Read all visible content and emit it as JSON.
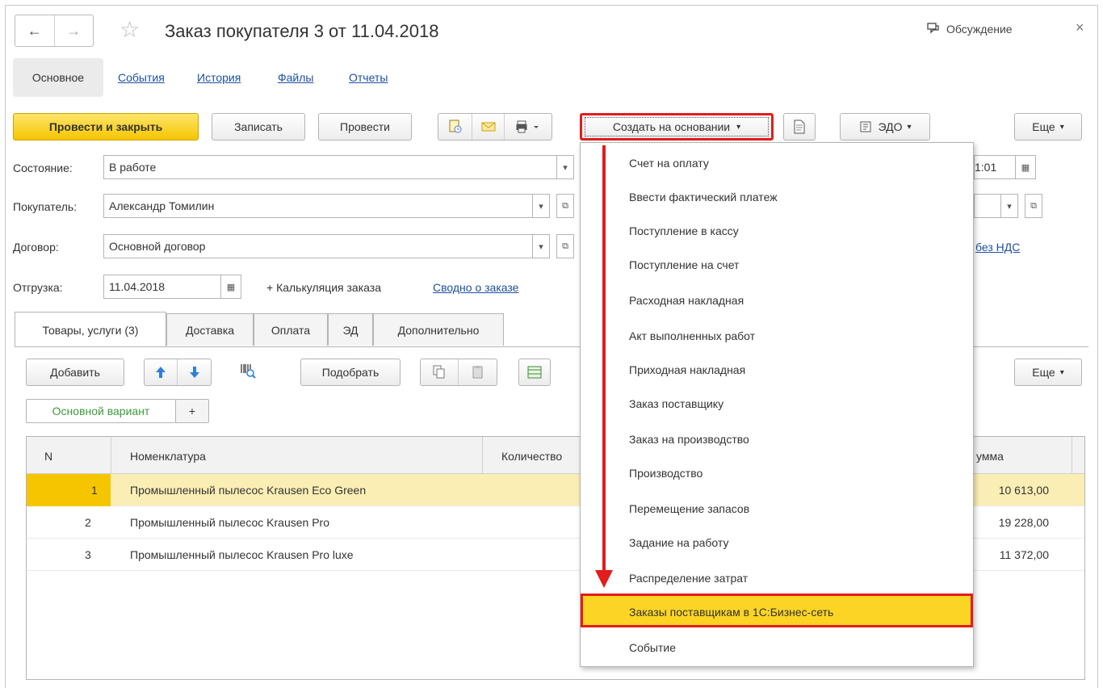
{
  "window": {
    "title": "Заказ покупателя 3 от 11.04.2018",
    "back": "←",
    "forward": "→",
    "star": "☆",
    "discussion": "Обсуждение",
    "close": "×"
  },
  "tabs": {
    "main": "Основное",
    "events": "События",
    "history": "История",
    "files": "Файлы",
    "reports": "Отчеты"
  },
  "toolbar": {
    "post_close": "Провести и закрыть",
    "save": "Записать",
    "post": "Провести",
    "create_based": "Создать на основании",
    "edo": "ЭДО",
    "more": "Еще"
  },
  "fields": {
    "state_label": "Состояние:",
    "state_value": "В работе",
    "buyer_label": "Покупатель:",
    "buyer_value": "Александр Томилин",
    "contract_label": "Договор:",
    "contract_value": "Основной договор",
    "ship_label": "Отгрузка:",
    "ship_value": "11.04.2018",
    "calc": "+ Калькуляция заказа",
    "summary": "Сводно о заказе",
    "time_partial": "1:01",
    "vat_partial": "без НДС"
  },
  "subtabs": [
    "Товары, услуги (3)",
    "Доставка",
    "Оплата",
    "ЭД",
    "Дополнительно"
  ],
  "table_toolbar": {
    "add": "Добавить",
    "pick": "Подобрать",
    "more": "Еще",
    "variant": "Основной вариант",
    "plus": "+"
  },
  "table": {
    "headers": {
      "n": "N",
      "item": "Номенклатура",
      "qty": "Количество",
      "sum_partial": "умма"
    },
    "rows": [
      {
        "n": "1",
        "item": "Промышленный пылесос Krausen Eco Green",
        "sum": "10 613,00"
      },
      {
        "n": "2",
        "item": "Промышленный пылесос Krausen Pro",
        "sum": "19 228,00"
      },
      {
        "n": "3",
        "item": "Промышленный пылесос Krausen Pro luxe",
        "sum": "11 372,00"
      }
    ]
  },
  "menu": {
    "items": [
      "Счет на оплату",
      "Ввести фактический платеж",
      "Поступление в кассу",
      "Поступление на счет",
      "Расходная накладная",
      "Акт выполненных работ",
      "Приходная накладная",
      "Заказ поставщику",
      "Заказ на производство",
      "Производство",
      "Перемещение запасов",
      "Задание на работу",
      "Распределение затрат",
      "Заказы поставщикам в 1С:Бизнес-сеть",
      "Событие"
    ],
    "highlighted_index": 13
  },
  "colors": {
    "accent_yellow": "#f5c600",
    "highlight_red": "#e31c1c",
    "link_blue": "#1f4fa0",
    "selected_row": "#fbeeb4"
  }
}
